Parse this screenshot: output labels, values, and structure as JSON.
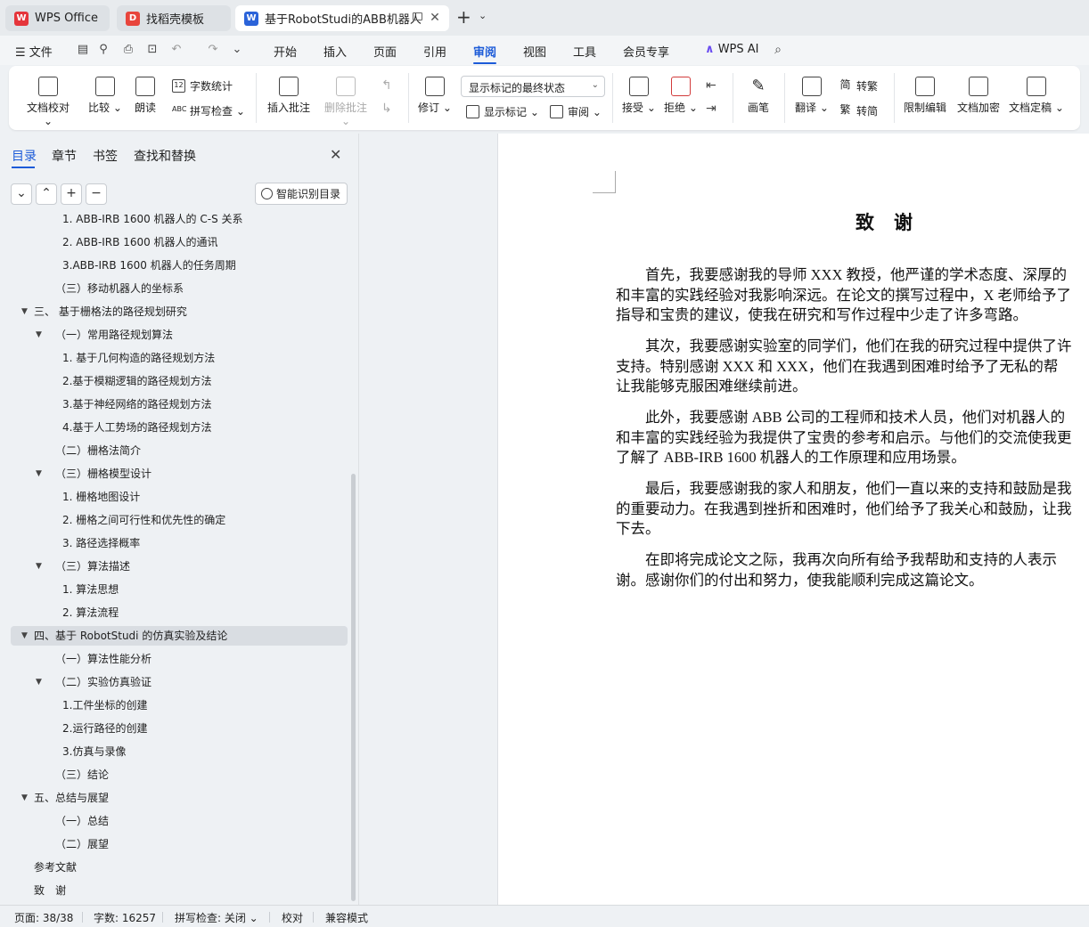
{
  "tabs": [
    {
      "label": "WPS Office",
      "icon": "wps-logo-icon"
    },
    {
      "label": "找稻壳模板",
      "icon": "docer-icon"
    },
    {
      "label": "基于RobotStudi的ABB机器人",
      "icon": "writer-doc-icon"
    }
  ],
  "menu": {
    "file": "文件",
    "items": [
      "开始",
      "插入",
      "页面",
      "引用",
      "审阅",
      "视图",
      "工具",
      "会员专享"
    ],
    "active": "审阅",
    "wps_ai": "WPS AI"
  },
  "ribbon": {
    "doc_check": "文档校对",
    "compare": "比较",
    "read_aloud": "朗读",
    "word_count": "字数统计",
    "spell_check": "拼写检查",
    "insert_comment": "插入批注",
    "delete_comment": "删除批注",
    "revise": "修订",
    "markup_state": "显示标记的最终状态",
    "show_markup": "显示标记",
    "review_pane": "审阅",
    "accept": "接受",
    "reject": "拒绝",
    "pen": "画笔",
    "translate": "翻译",
    "to_traditional": "转繁",
    "to_simplified": "转简",
    "restrict_edit": "限制编辑",
    "encrypt": "文档加密",
    "finalize": "文档定稿"
  },
  "nav": {
    "tabs": [
      "目录",
      "章节",
      "书签",
      "查找和替换"
    ],
    "smart_toc": "智能识别目录",
    "toc": [
      {
        "text": "1. ABB-IRB 1600 机器人的 C-S 关系",
        "indent": 3,
        "arrow": ""
      },
      {
        "text": "2. ABB-IRB 1600 机器人的通讯",
        "indent": 3,
        "arrow": ""
      },
      {
        "text": "3.ABB-IRB 1600 机器人的任务周期",
        "indent": 3,
        "arrow": ""
      },
      {
        "text": "（三）移动机器人的坐标系",
        "indent": 2,
        "arrow": ""
      },
      {
        "text": "三、 基于栅格法的路径规划研究",
        "indent": 1,
        "arrow": "▼"
      },
      {
        "text": "（一）常用路径规划算法",
        "indent": 2,
        "arrow": "▼"
      },
      {
        "text": "1. 基于几何构造的路径规划方法",
        "indent": 3,
        "arrow": ""
      },
      {
        "text": "2.基于模糊逻辑的路径规划方法",
        "indent": 3,
        "arrow": ""
      },
      {
        "text": "3.基于神经网络的路径规划方法",
        "indent": 3,
        "arrow": ""
      },
      {
        "text": "4.基于人工势场的路径规划方法",
        "indent": 3,
        "arrow": ""
      },
      {
        "text": "（二）栅格法简介",
        "indent": 2,
        "arrow": ""
      },
      {
        "text": "（三）栅格模型设计",
        "indent": 2,
        "arrow": "▼"
      },
      {
        "text": "1. 栅格地图设计",
        "indent": 3,
        "arrow": ""
      },
      {
        "text": "2. 栅格之间可行性和优先性的确定",
        "indent": 3,
        "arrow": ""
      },
      {
        "text": "3. 路径选择概率",
        "indent": 3,
        "arrow": ""
      },
      {
        "text": "（三）算法描述",
        "indent": 2,
        "arrow": "▼"
      },
      {
        "text": "1. 算法思想",
        "indent": 3,
        "arrow": ""
      },
      {
        "text": "2. 算法流程",
        "indent": 3,
        "arrow": ""
      },
      {
        "text": "四、基于 RobotStudi 的仿真实验及结论",
        "indent": 1,
        "arrow": "▼",
        "selected": true
      },
      {
        "text": "（一）算法性能分析",
        "indent": 2,
        "arrow": ""
      },
      {
        "text": "（二）实验仿真验证",
        "indent": 2,
        "arrow": "▼"
      },
      {
        "text": "1.工件坐标的创建",
        "indent": 3,
        "arrow": ""
      },
      {
        "text": "2.运行路径的创建",
        "indent": 3,
        "arrow": ""
      },
      {
        "text": "3.仿真与录像",
        "indent": 3,
        "arrow": ""
      },
      {
        "text": "（三）结论",
        "indent": 2,
        "arrow": ""
      },
      {
        "text": "五、总结与展望",
        "indent": 1,
        "arrow": "▼"
      },
      {
        "text": "（一）总结",
        "indent": 2,
        "arrow": ""
      },
      {
        "text": "（二）展望",
        "indent": 2,
        "arrow": ""
      },
      {
        "text": "参考文献",
        "indent": 1,
        "arrow": ""
      },
      {
        "text": "致　谢",
        "indent": 1,
        "arrow": ""
      }
    ]
  },
  "document": {
    "title": "致谢",
    "paragraphs": [
      [
        "　　首先，我要感谢我的导师 XXX 教授，他严谨的学术态度、深厚的",
        "和丰富的实践经验对我影响深远。在论文的撰写过程中，X 老师给予了",
        "指导和宝贵的建议，使我在研究和写作过程中少走了许多弯路。"
      ],
      [
        "　　其次，我要感谢实验室的同学们，他们在我的研究过程中提供了许",
        "支持。特别感谢 XXX 和 XXX，他们在我遇到困难时给予了无私的帮",
        "让我能够克服困难继续前进。"
      ],
      [
        "　　此外，我要感谢 ABB 公司的工程师和技术人员，他们对机器人的",
        "和丰富的实践经验为我提供了宝贵的参考和启示。与他们的交流使我更",
        "了解了 ABB-IRB 1600 机器人的工作原理和应用场景。"
      ],
      [
        "　　最后，我要感谢我的家人和朋友，他们一直以来的支持和鼓励是我",
        "的重要动力。在我遇到挫折和困难时，他们给予了我关心和鼓励，让我",
        "下去。"
      ],
      [
        "　　在即将完成论文之际，我再次向所有给予我帮助和支持的人表示",
        "谢。感谢你们的付出和努力，使我能顺利完成这篇论文。"
      ]
    ]
  },
  "status": {
    "page": "页面: 38/38",
    "words": "字数: 16257",
    "spell": "拼写检查: 关闭",
    "proof": "校对",
    "compat": "兼容模式"
  },
  "colors": {
    "accent": "#1c5bd8",
    "wps_red": "#e5353b",
    "docer_red": "#e8453c",
    "writer_blue": "#2b63d9"
  }
}
